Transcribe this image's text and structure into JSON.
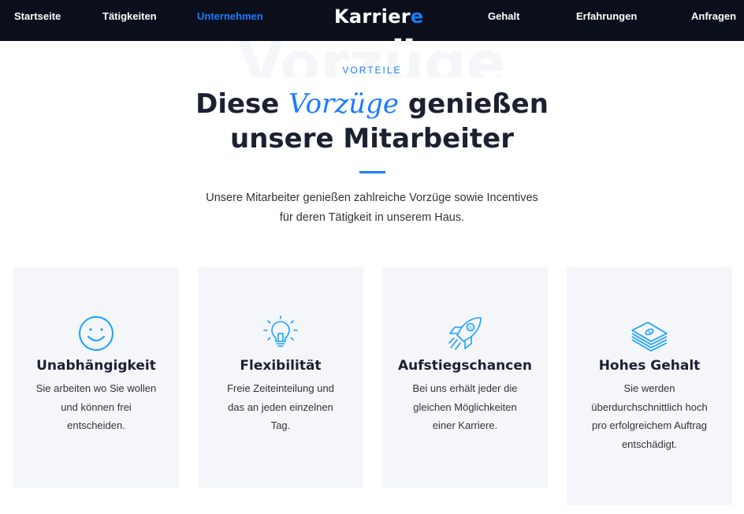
{
  "nav": {
    "items": [
      {
        "label": "Startseite",
        "active": false
      },
      {
        "label": "Tätigkeiten",
        "active": false
      },
      {
        "label": "Unternehmen",
        "active": true
      },
      {
        "label": "Gehalt",
        "active": false
      },
      {
        "label": "Erfahrungen",
        "active": false
      },
      {
        "label": "Anfragen",
        "active": false
      }
    ],
    "logo_main": "Karrier",
    "logo_accent": "e"
  },
  "hero": {
    "watermark": "Vorzüge",
    "eyebrow": "VORTEILE",
    "headline_pre": "Diese ",
    "headline_highlight": "Vorzüge",
    "headline_post": " genießen",
    "headline_line2": "unsere Mitarbeiter",
    "intro_line1": "Unsere Mitarbeiter genießen zahlreiche Vorzüge sowie Incentives",
    "intro_line2": "für deren Tätigkeit in unserem Haus."
  },
  "cards": [
    {
      "icon": "smiley-icon",
      "title": "Unabhängigkeit",
      "lines": [
        "Sie arbeiten wo Sie wollen",
        "und können frei",
        "entscheiden."
      ]
    },
    {
      "icon": "lightbulb-icon",
      "title": "Flexibilität",
      "lines": [
        "Freie Zeiteinteilung und",
        "das an jeden einzelnen",
        "Tag."
      ]
    },
    {
      "icon": "rocket-icon",
      "title": "Aufstiegschancen",
      "lines": [
        "Bei uns erhält jeder die",
        "gleichen Möglichkeiten",
        "einer Karriere."
      ]
    },
    {
      "icon": "money-stack-icon",
      "title": "Hohes Gehalt",
      "lines": [
        "Sie werden",
        "überdurchschnittlich hoch",
        "pro erfolgreichem Auftrag",
        "entschädigt."
      ]
    }
  ],
  "colors": {
    "accent": "#1a7cff",
    "nav_bg": "#0b0f1c",
    "card_bg": "#f4f6fa",
    "heading": "#1c2131"
  }
}
